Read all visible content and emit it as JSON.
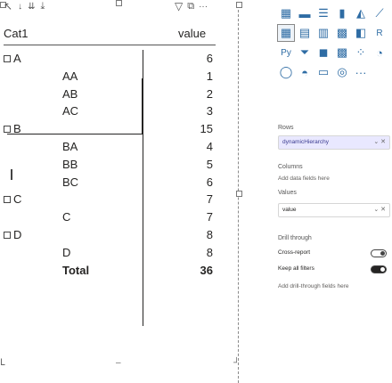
{
  "matrix": {
    "headers": {
      "rows": "Cat1",
      "values": "value"
    },
    "rows": [
      {
        "label": "A",
        "value": "6",
        "level": 0,
        "collapsible": true
      },
      {
        "label": "AA",
        "value": "1",
        "level": 1
      },
      {
        "label": "AB",
        "value": "2",
        "level": 1
      },
      {
        "label": "AC",
        "value": "3",
        "level": 1
      },
      {
        "label": "B",
        "value": "15",
        "level": 0,
        "collapsible": true
      },
      {
        "label": "BA",
        "value": "4",
        "level": 1
      },
      {
        "label": "BB",
        "value": "5",
        "level": 1
      },
      {
        "label": "BC",
        "value": "6",
        "level": 1
      },
      {
        "label": "C",
        "value": "7",
        "level": 0,
        "collapsible": true
      },
      {
        "label": "C",
        "value": "7",
        "level": 1
      },
      {
        "label": "D",
        "value": "8",
        "level": 0,
        "collapsible": true
      },
      {
        "label": "D",
        "value": "8",
        "level": 1
      },
      {
        "label": "Total",
        "value": "36",
        "total": true
      }
    ]
  },
  "pane": {
    "rows_section": "Rows",
    "rows_field": "dynamicHierarchy",
    "columns_section": "Columns",
    "columns_hint": "Add data fields here",
    "values_section": "Values",
    "values_field": "value",
    "drill_section": "Drill through",
    "cross_report": "Cross-report",
    "keep_filters": "Keep all filters",
    "drill_hint": "Add drill-through fields here",
    "visual_icons": [
      "table-icon",
      "stacked-bar-icon",
      "clustered-bar-icon",
      "stacked-column-icon",
      "area-icon",
      "line-icon",
      "matrix-icon",
      "ribbon-icon",
      "waterfall-icon",
      "bar-chart-icon",
      "map-icon",
      "slicer-icon",
      "python-icon",
      "funnel-icon",
      "kpi-icon",
      "r-icon",
      "scatter-icon",
      "pie-icon",
      "donut-icon",
      "gauge-icon",
      "card-icon",
      "key-influencers-icon",
      "more-icon"
    ]
  }
}
